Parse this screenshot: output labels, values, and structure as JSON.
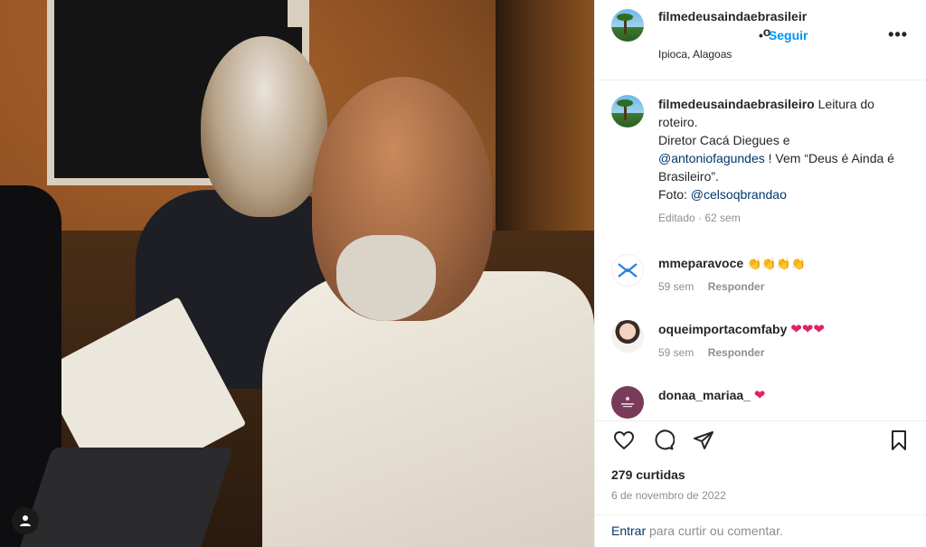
{
  "post": {
    "username": "filmedeusaindaebrasileir",
    "username_wrap": "o",
    "location": "Ipioca, Alagoas",
    "follow_label": "Seguir",
    "follow_dot": "•",
    "more_label": "•••"
  },
  "caption": {
    "username": "filmedeusaindaebrasileiro",
    "line1": " Leitura do roteiro.",
    "line2": "Diretor Cacá Diegues e ",
    "mention1": "@antoniofagundes",
    "line3": " ! Vem “Deus é Ainda é Brasileiro”.",
    "line4": "Foto: ",
    "mention2": "@celsoqbrandao",
    "edited": "Editado",
    "time": "62 sem"
  },
  "comments": [
    {
      "username": "mmeparavoce",
      "text": "👏👏👏👏",
      "time": "59 sem",
      "reply": "Responder"
    },
    {
      "username": "oqueimportacomfaby",
      "text": "❤❤❤",
      "time": "59 sem",
      "reply": "Responder"
    },
    {
      "username": "donaa_mariaa_",
      "text": "❤"
    }
  ],
  "stats": {
    "likes": "279 curtidas",
    "date": "6 de novembro de 2022"
  },
  "login": {
    "enter": "Entrar",
    "rest": " para curtir ou comentar."
  },
  "icons": {
    "like": "heart-outline-icon",
    "comment": "comment-bubble-icon",
    "share": "paper-plane-icon",
    "save": "bookmark-icon",
    "user": "user-icon"
  },
  "colors": {
    "accent": "#0095f6",
    "link": "#00376b",
    "muted": "#8e8e8e",
    "heart": "#e0245e"
  }
}
